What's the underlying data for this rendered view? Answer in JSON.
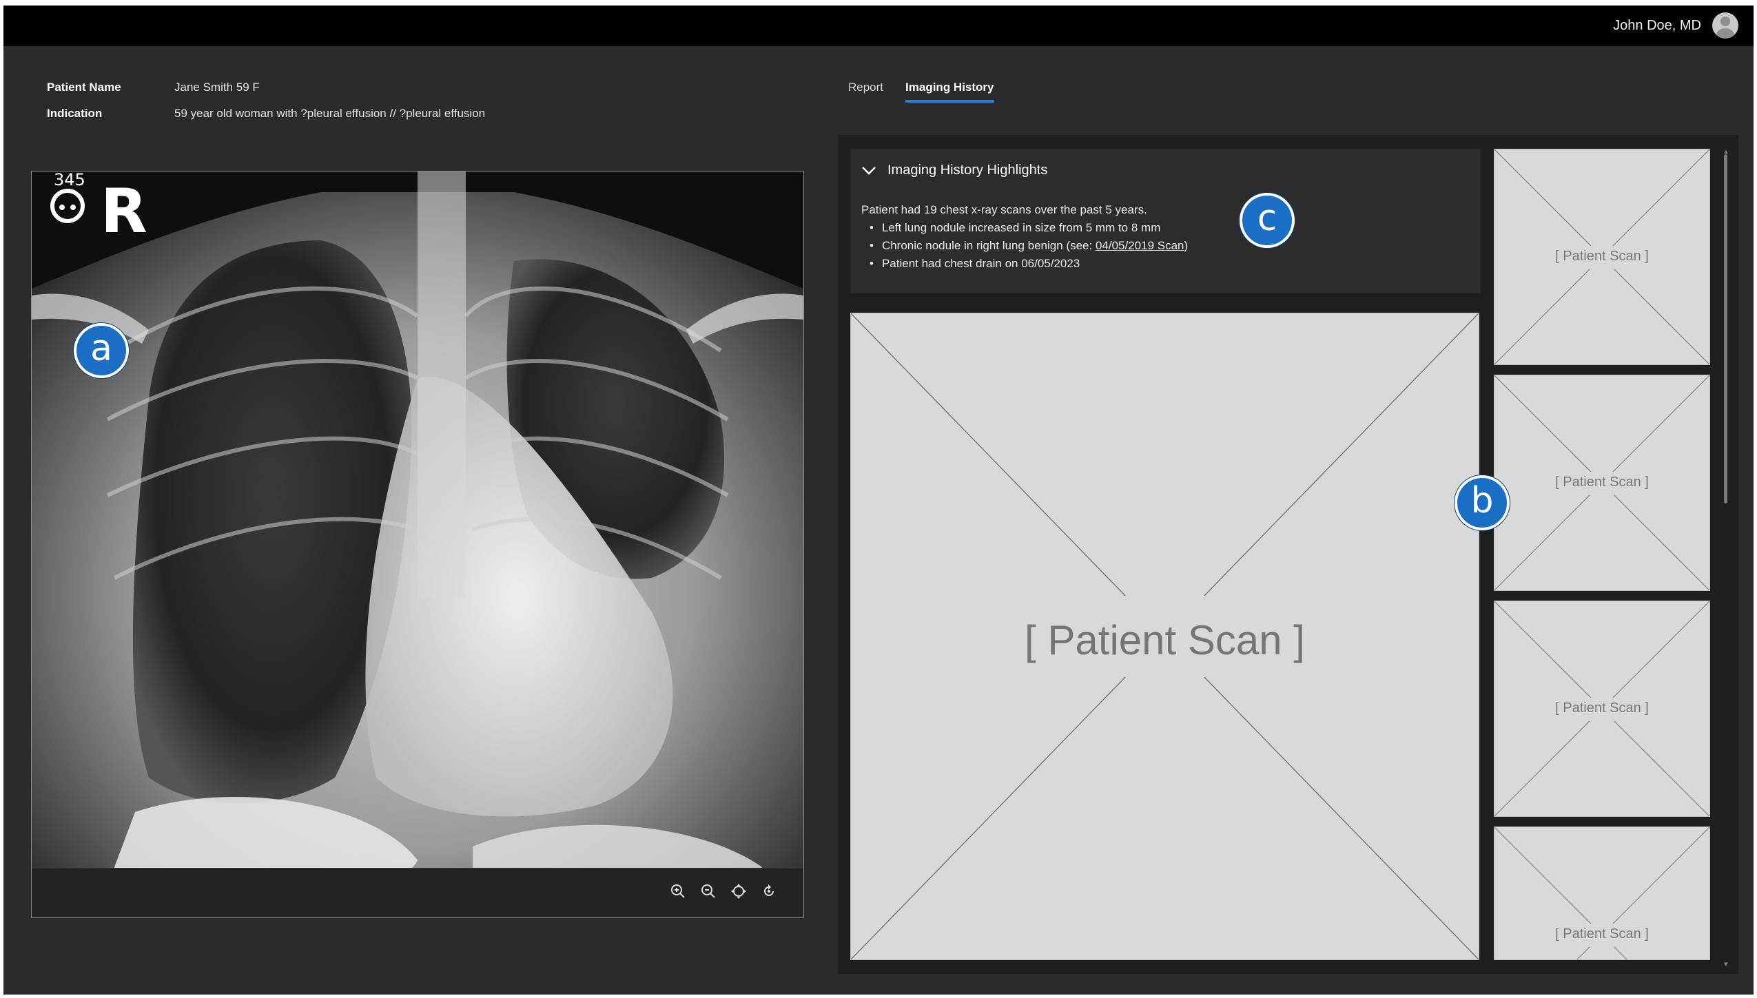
{
  "header": {
    "user_name": "John Doe, MD"
  },
  "patient": {
    "name_label": "Patient Name",
    "name_value": "Jane Smith 59 F",
    "indication_label": "Indication",
    "indication_value": "59 year old woman with ?pleural effusion // ?pleural effusion"
  },
  "tabs": [
    {
      "label": "Report",
      "active": false
    },
    {
      "label": "Imaging History",
      "active": true
    }
  ],
  "viewer": {
    "film_marker": "R",
    "film_number": "345",
    "tools": [
      "zoom-in-icon",
      "zoom-out-icon",
      "pan-icon",
      "rotate-icon"
    ]
  },
  "highlights": {
    "title": "Imaging History Highlights",
    "summary": "Patient had 19 chest x-ray scans over the past 5 years.",
    "items": [
      "Left lung nodule increased in size from 5 mm to 8 mm",
      "Chronic nodule in right lung benign (see: ",
      "Patient had chest drain on 06/05/2023"
    ],
    "link_text": "04/05/2019 Scan",
    "link_suffix": ")"
  },
  "scans": {
    "main_label": "[ Patient Scan ]",
    "thumbnails": [
      "[ Patient Scan ]",
      "[ Patient Scan ]",
      "[ Patient Scan ]",
      "[ Patient Scan ]"
    ]
  },
  "callouts": {
    "a": "a",
    "b": "b",
    "c": "c"
  },
  "colors": {
    "accent": "#2b7fd8",
    "callout": "#1a6fc4",
    "background": "#2b2b2b",
    "topbar": "#000000"
  }
}
